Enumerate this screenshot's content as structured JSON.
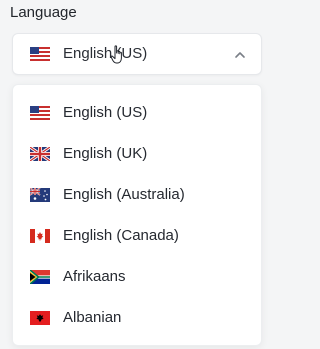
{
  "field": {
    "label": "Language"
  },
  "select": {
    "value": "English (US)",
    "flag": "us-flag-icon",
    "chevron": "chevron-up-icon",
    "open": true
  },
  "options": [
    {
      "label": "English (US)",
      "flag": "us-flag-icon"
    },
    {
      "label": "English (UK)",
      "flag": "uk-flag-icon"
    },
    {
      "label": "English (Australia)",
      "flag": "australia-flag-icon"
    },
    {
      "label": "English (Canada)",
      "flag": "canada-flag-icon"
    },
    {
      "label": "Afrikaans",
      "flag": "south-africa-flag-icon"
    },
    {
      "label": "Albanian",
      "flag": "albania-flag-icon"
    }
  ],
  "colors": {
    "background": "#f4f5f6",
    "panel": "#ffffff",
    "border": "#e6e8eb",
    "text": "#252930"
  }
}
